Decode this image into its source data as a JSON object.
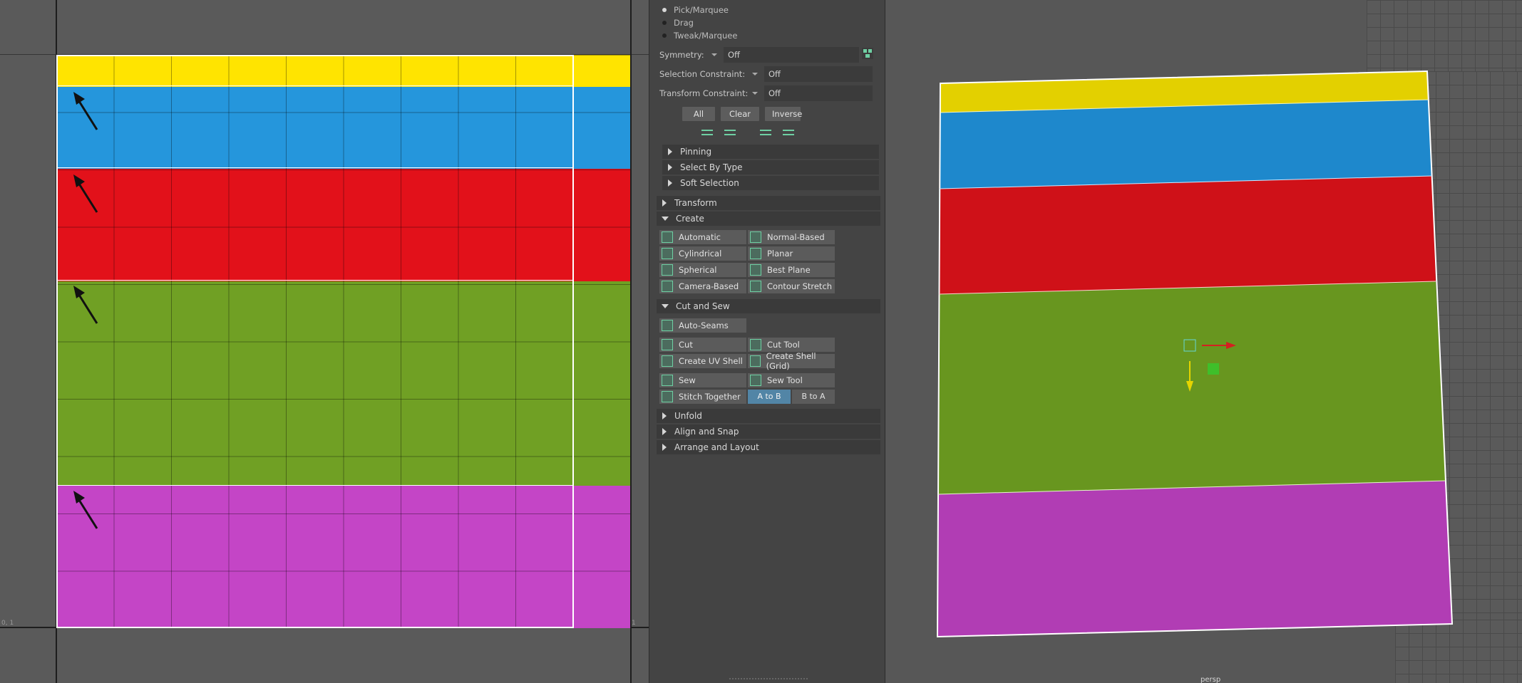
{
  "toolkit": {
    "selection_modes": [
      {
        "label": "Pick/Marquee",
        "selected": true
      },
      {
        "label": "Drag",
        "selected": false
      },
      {
        "label": "Tweak/Marquee",
        "selected": false
      }
    ],
    "symmetry": {
      "label": "Symmetry:",
      "value": "Off"
    },
    "selection_constraint": {
      "label": "Selection Constraint:",
      "value": "Off"
    },
    "transform_constraint": {
      "label": "Transform Constraint:",
      "value": "Off"
    },
    "buttons": {
      "all": "All",
      "clear": "Clear",
      "inverse": "Inverse"
    },
    "sections": {
      "pinning": "Pinning",
      "select_by_type": "Select By Type",
      "soft_selection": "Soft Selection",
      "transform": "Transform",
      "create": "Create",
      "cut_and_sew": "Cut and Sew",
      "unfold": "Unfold",
      "align_and_snap": "Align and Snap",
      "arrange_and_layout": "Arrange and Layout"
    },
    "create_tools": {
      "automatic": "Automatic",
      "normal_based": "Normal-Based",
      "cylindrical": "Cylindrical",
      "planar": "Planar",
      "spherical": "Spherical",
      "best_plane": "Best Plane",
      "camera_based": "Camera-Based",
      "contour_stretch": "Contour Stretch"
    },
    "cut_sew_tools": {
      "auto_seams": "Auto-Seams",
      "cut": "Cut",
      "cut_tool": "Cut Tool",
      "create_uv_shell": "Create UV Shell",
      "create_shell_grid": "Create Shell (Grid)",
      "sew": "Sew",
      "sew_tool": "Sew Tool",
      "stitch_together": "Stitch Together",
      "a_to_b": "A to B",
      "b_to_a": "B to A"
    }
  },
  "uv_editor": {
    "corner_label_bottom_left": "0, 1",
    "corner_label_bottom_right": "1",
    "bands": [
      {
        "name": "yellow",
        "color": "#ffe400"
      },
      {
        "name": "blue",
        "color": "#2596dc"
      },
      {
        "name": "red",
        "color": "#e2111a"
      },
      {
        "name": "green",
        "color": "#70a024"
      },
      {
        "name": "magenta",
        "color": "#c445c6"
      }
    ]
  },
  "viewport": {
    "camera_label": "persp",
    "colors": {
      "yellow": "#e3d000",
      "blue": "#1e88cc",
      "red": "#cf1118",
      "green": "#68961f",
      "magenta": "#b13db4",
      "manip_x": "#d42020",
      "manip_y": "#e6d400",
      "manip_z": "#3fbf2a"
    }
  }
}
